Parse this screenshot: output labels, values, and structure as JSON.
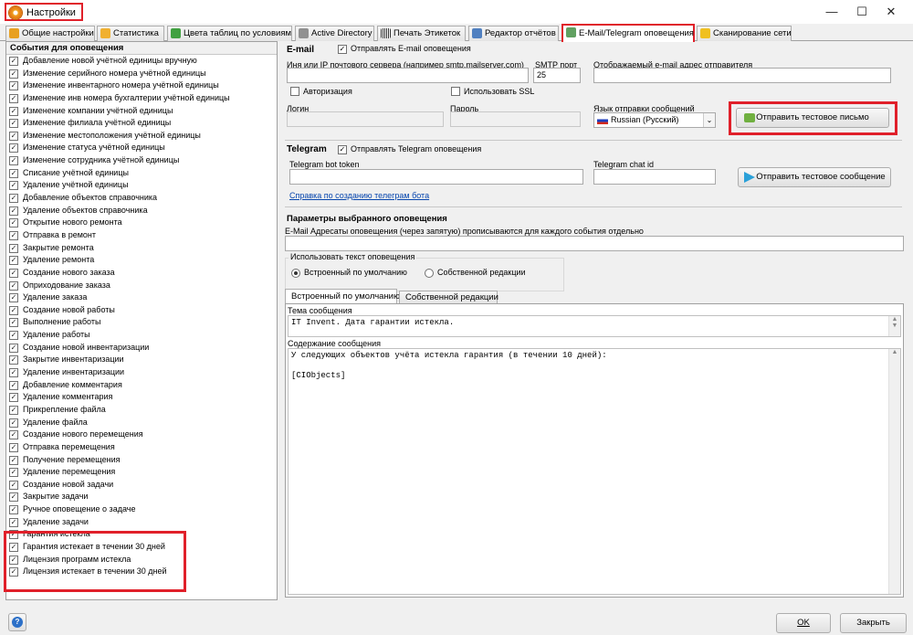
{
  "window": {
    "title": "Настройки",
    "min": "—",
    "max": "☐",
    "close": "✕"
  },
  "tabs": [
    {
      "label": "Общие настройки",
      "color": "#e8a020"
    },
    {
      "label": "Статистика",
      "color": "#f0b030"
    },
    {
      "label": "Цвета таблиц по условиям",
      "color": "#40a040"
    },
    {
      "label": "Active Directory",
      "color": "#808080"
    },
    {
      "label": "Печать Этикеток",
      "color": "#404040"
    },
    {
      "label": "Редактор отчётов",
      "color": "#5080c0"
    },
    {
      "label": "E-Mail/Telegram оповещения",
      "color": "#60a060"
    },
    {
      "label": "Сканирование сети",
      "color": "#f0c020"
    }
  ],
  "events": {
    "header": "События для оповещения",
    "selected_index": 43,
    "items": [
      "Добавление новой учётной единицы вручную",
      "Изменение серийного номера учётной единицы",
      "Изменение инвентарного номера учётной единицы",
      "Изменение инв номера бухгалтерии учётной единицы",
      "Изменение компании учётной единицы",
      "Изменение филиала учётной единицы",
      "Изменение местоположения учётной единицы",
      "Изменение статуса учётной единицы",
      "Изменение сотрудника учётной единицы",
      "Списание учётной единицы",
      "Удаление учётной единицы",
      "Добавление объектов справочника",
      "Удаление объектов справочника",
      "Открытие нового ремонта",
      "Отправка в ремонт",
      "Закрытие ремонта",
      "Удаление ремонта",
      "Создание нового заказа",
      "Оприходование заказа",
      "Удаление заказа",
      "Создание новой работы",
      "Выполнение работы",
      "Удаление работы",
      "Создание новой инвентаризации",
      "Закрытие инвентаризации",
      "Удаление инвентаризации",
      "Добавление комментария",
      "Удаление комментария",
      "Прикрепление файла",
      "Удаление файла",
      "Создание нового перемещения",
      "Отправка перемещения",
      "Получение перемещения",
      "Удаление перемещения",
      "Создание новой задачи",
      "Закрытие задачи",
      "Ручное оповещение о задаче",
      "Удаление задачи",
      "Гарантия истекла",
      "Гарантия истекает в течении 30 дней",
      "Лицензия программ истекла",
      "Лицензия истекает в течении 30 дней"
    ]
  },
  "email": {
    "section": "E-mail",
    "enable_label": "Отправлять E-mail оповещения",
    "server_label": "Иня или IP почтового сервера (например smtp.mailserver.com)",
    "server_value": "",
    "port_label": "SMTP порт",
    "port_value": "25",
    "sender_label": "Отображаемый e-mail адрес отправителя",
    "sender_value": "",
    "auth_label": "Авторизация",
    "ssl_label": "Использовать SSL",
    "login_label": "Логин",
    "password_label": "Пароль",
    "lang_label": "Язык отправки сообщений",
    "lang_value": "Russian (Русский)",
    "test_button": "Отправить тестовое письмо"
  },
  "telegram": {
    "section": "Telegram",
    "enable_label": "Отправлять Telegram оповещения",
    "token_label": "Telegram bot token",
    "chat_label": "Telegram chat id",
    "test_button": "Отправить тестовое сообщение",
    "help_link": "Справка по созданию телеграм бота"
  },
  "params": {
    "section": "Параметры выбранного оповещения",
    "addresses_label": "E-Mail Адресаты оповещения (через запятую) прописываются для каждого события отдельно",
    "addresses_value": "",
    "text_group": "Использовать текст оповещения",
    "radio_default": "Встроенный по умолчанию",
    "radio_custom": "Собственной редакции",
    "tab_default": "Встроенный по умолчанию",
    "tab_custom": "Собственной редакции",
    "subject_label": "Тема сообщения",
    "subject_value": "IT Invent. Дата гарантии истекла.",
    "body_label": "Содержание сообщения",
    "body_value": "У следующих объектов учёта истекла гарантия (в течении 10 дней):\n\n[CIObjects]"
  },
  "footer": {
    "help_icon": "?",
    "ok": "OK",
    "close": "Закрыть"
  }
}
